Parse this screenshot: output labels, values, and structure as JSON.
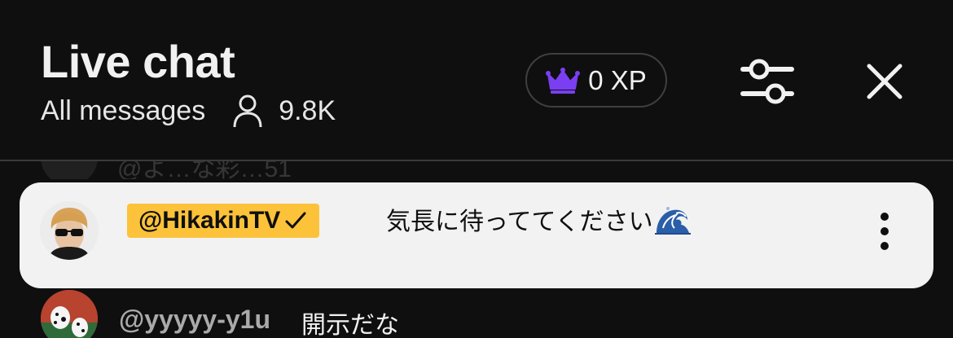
{
  "header": {
    "title": "Live chat",
    "mode": "All messages",
    "viewer_count": "9.8K",
    "xp_label": "0 XP"
  },
  "faded_message": {
    "text": "@よ…な彩…51"
  },
  "pinned": {
    "author": "@HikakinTV",
    "message": "気長に待っててください",
    "emoji": "wave-emoji"
  },
  "messages": [
    {
      "author": "@yyyyy-y1u",
      "text": "開示だな"
    }
  ],
  "icons": {
    "viewer": "person-icon",
    "xp": "crown-icon",
    "filter": "sliders-icon",
    "close": "close-icon",
    "more": "more-vert-icon",
    "verified": "check-icon"
  },
  "colors": {
    "background": "#0f0f0f",
    "badge": "#fcc23a",
    "crown": "#7a3ff2",
    "card": "#f2f2f2"
  }
}
